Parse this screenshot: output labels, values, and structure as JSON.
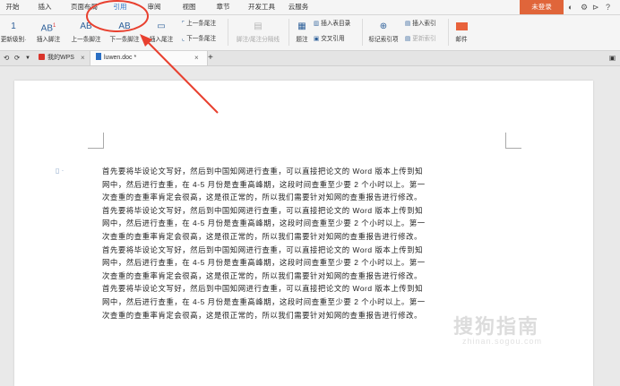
{
  "menu": {
    "tabs": [
      "开始",
      "插入",
      "页面布局",
      "引用",
      "审阅",
      "视图",
      "章节",
      "开发工具",
      "云服务"
    ],
    "active": "引用",
    "login": "未登录"
  },
  "ribbon": {
    "level_label": "更新级别·",
    "insert_footnote": "插入脚注",
    "prev_footnote": "上一条脚注",
    "next_footnote": "下一条脚注",
    "insert_endnote": "插入尾注",
    "prev_endnote_top": "上一条尾注",
    "next_endnote": "下一条尾注",
    "separator_line": "脚注/尾注分隔线",
    "caption": "题注",
    "insert_toc": "插入表目录",
    "cross_ref": "交叉引用",
    "mark_index": "标记索引项",
    "insert_index": "插入索引",
    "update_index": "更新索引",
    "mail": "邮件"
  },
  "tabs": {
    "wps": "我的WPS",
    "doc": "luwen.doc *"
  },
  "document": {
    "lines": [
      "首先要将毕设论文写好，然后到中国知网进行查重，可以直接把论文的 Word 版本上传到知",
      "网中，然后进行查重，在 4-5 月份是查重高峰期，这段时间查重至少要 2 个小时以上。第一",
      "次查重的查重率肯定会很高，这是很正常的，所以我们需要针对知网的查重报告进行修改。",
      "首先要将毕设论文写好，然后到中国知网进行查重，可以直接把论文的 Word 版本上传到知",
      "网中，然后进行查重，在 4-5 月份是查重高峰期，这段时间查重至少要 2 个小时以上。第一",
      "次查重的查重率肯定会很高，这是很正常的，所以我们需要针对知网的查重报告进行修改。",
      "首先要将毕设论文写好，然后到中国知网进行查重，可以直接把论文的 Word 版本上传到知",
      "网中，然后进行查重，在 4-5 月份是查重高峰期，这段时间查重至少要 2 个小时以上。第一",
      "次查重的查重率肯定会很高，这是很正常的，所以我们需要针对知网的查重报告进行修改。",
      "首先要将毕设论文写好，然后到中国知网进行查重，可以直接把论文的 Word 版本上传到知",
      "网中，然后进行查重，在 4-5 月份是查重高峰期，这段时间查重至少要 2 个小时以上。第一",
      "次查重的查重率肯定会很高，这是很正常的，所以我们需要针对知网的查重报告进行修改。"
    ]
  },
  "watermark": {
    "main": "搜狗指南",
    "sub": "zhinan.sogou.com"
  },
  "colors": {
    "accent": "#2a74c8",
    "login": "#e0653a",
    "annotation": "#e8402f"
  }
}
